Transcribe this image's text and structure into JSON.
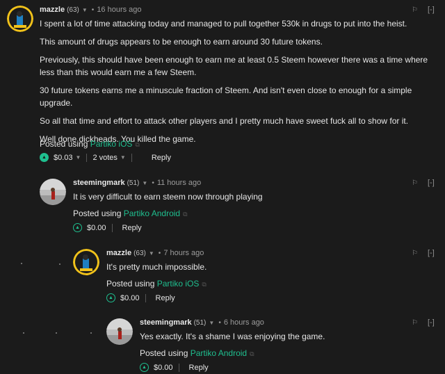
{
  "comments": [
    {
      "author": "mazzle",
      "reputation": "(63)",
      "time": "16 hours ago",
      "paragraphs": [
        "I spent a lot of time attacking today and managed to pull together 530k in drugs to put into the heist.",
        "This amount of drugs appears to be enough to earn around 30 future tokens.",
        "Previously, this should have been enough to earn me at least 0.5 Steem however there was a time where less than this would earn me a few Steem.",
        "30 future tokens earns me a minuscule fraction of Steem. And isn't even close to enough for a simple upgrade.",
        "So all that time and effort to attack other players and I pretty much have sweet fuck all to show for it.",
        "Well done dickheads. You killed the game."
      ],
      "posted_prefix": "Posted using ",
      "app": "Partiko iOS",
      "payout": "$0.03",
      "votes": "2 votes",
      "reply": "Reply",
      "collapse": "[-]"
    },
    {
      "author": "steemingmark",
      "reputation": "(51)",
      "time": "11 hours ago",
      "paragraphs": [
        "It is very difficult to earn steem now through playing"
      ],
      "posted_prefix": "Posted using ",
      "app": "Partiko Android",
      "payout": "$0.00",
      "reply": "Reply",
      "collapse": "[-]"
    },
    {
      "author": "mazzle",
      "reputation": "(63)",
      "time": "7 hours ago",
      "paragraphs": [
        "It's pretty much impossible."
      ],
      "posted_prefix": "Posted using ",
      "app": "Partiko iOS",
      "payout": "$0.00",
      "reply": "Reply",
      "collapse": "[-]"
    },
    {
      "author": "steemingmark",
      "reputation": "(51)",
      "time": "6 hours ago",
      "paragraphs": [
        "Yes exactly. It's a shame I was enjoying the game."
      ],
      "posted_prefix": "Posted using ",
      "app": "Partiko Android",
      "payout": "$0.00",
      "reply": "Reply",
      "collapse": "[-]"
    }
  ],
  "colors": {
    "background": "#1b1b1b",
    "accent": "#1fbf8f",
    "text": "#e6e6e6",
    "muted": "#9c9c9c"
  },
  "icons": {
    "upvote": "chevron-up-icon",
    "flag": "flag-icon",
    "dropdown": "caret-down-icon",
    "external": "external-link-icon"
  }
}
